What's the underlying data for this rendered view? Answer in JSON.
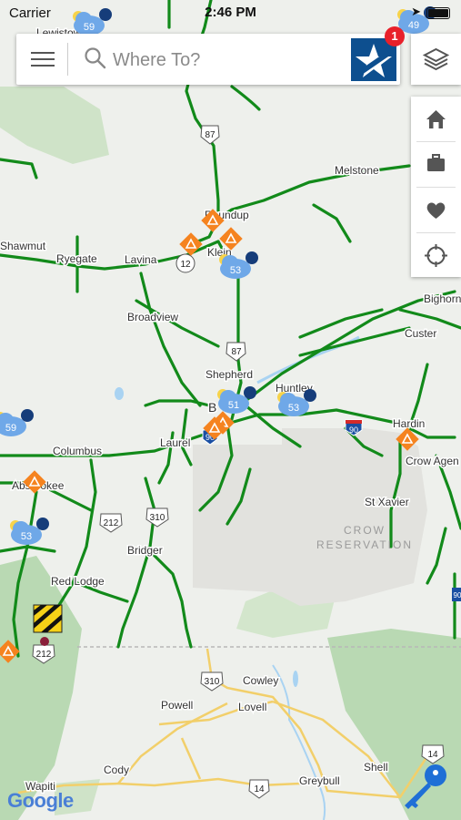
{
  "status": {
    "carrier": "Carrier",
    "time": "2:46 PM"
  },
  "search": {
    "placeholder": "Where To?",
    "notification_count": "1"
  },
  "map": {
    "reservation_label_line1": "CROW",
    "reservation_label_line2": "RESERVATION",
    "towns": {
      "lewistown": "Lewistown",
      "melstone": "Melstone",
      "roundup": "Roundup",
      "shawmut": "Shawmut",
      "ryegate": "Ryegate",
      "lavina": "Lavina",
      "klein": "Klein",
      "broadview": "Broadview",
      "shepherd": "Shepherd",
      "huntley": "Huntley",
      "billings": "B",
      "bighorn": "Bighorn",
      "custer": "Custer",
      "hardin": "Hardin",
      "crow_agency": "Crow Agen",
      "columbus": "Columbus",
      "laurel": "Laurel",
      "absarokee": "Absarokee",
      "st_xavier": "St Xavier",
      "bridger": "Bridger",
      "red_lodge": "Red Lodge",
      "cowley": "Cowley",
      "powell": "Powell",
      "lovell": "Lovell",
      "cody": "Cody",
      "shell": "Shell",
      "wapiti": "Wapiti",
      "greybull": "Greybull"
    },
    "shields": {
      "us87_north": "87",
      "mt12": "12",
      "us87_south": "87",
      "us212_a": "212",
      "us310_a": "310",
      "us212_b": "212",
      "us310_b": "310",
      "us14_a": "14",
      "us14_b": "14",
      "i90_a": "90",
      "i90_b": "90",
      "i90_c": "90"
    },
    "weather": {
      "w1": "59",
      "w2": "49",
      "w3": "53",
      "w4": "51",
      "w5": "53",
      "w6": "59",
      "w7": "53"
    }
  },
  "attribution": "Google",
  "colors": {
    "road_open": "#128a1a",
    "highway_minor": "#f2cf6a",
    "warning_orange": "#f5831f",
    "brand_blue": "#0d4f8f",
    "weather_cloud": "#6fa8e8"
  },
  "icons": {
    "menu": "hamburger-icon",
    "search": "search-icon",
    "logo": "star-logo-icon",
    "layers": "layers-icon",
    "home": "home-icon",
    "work": "briefcase-icon",
    "favorites": "heart-icon",
    "locate": "crosshair-icon",
    "key": "key-icon"
  }
}
